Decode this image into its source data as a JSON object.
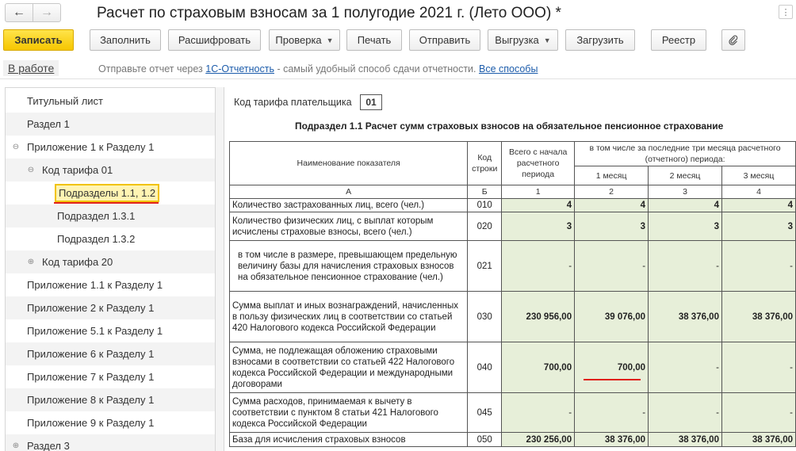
{
  "window": {
    "title": "Расчет по страховым взносам за 1 полугодие 2021 г. (Лето ООО) *",
    "back_icon": "arrow-left-icon",
    "forward_icon": "arrow-right-icon"
  },
  "toolbar": {
    "save": "Записать",
    "fill": "Заполнить",
    "decode": "Расшифровать",
    "check": "Проверка",
    "print": "Печать",
    "send": "Отправить",
    "export": "Выгрузка",
    "load": "Загрузить",
    "registry": "Реестр"
  },
  "status": {
    "in_work": "В работе",
    "msg_prefix": "Отправьте отчет через ",
    "link_1c": "1С-Отчетность",
    "msg_middle": " - самый удобный способ сдачи отчетности. ",
    "link_all": "Все способы"
  },
  "tree": {
    "items": [
      {
        "label": "Титульный лист",
        "toggle": ""
      },
      {
        "label": "Раздел 1",
        "toggle": ""
      },
      {
        "label": "Приложение 1 к Разделу 1",
        "toggle": "⊖"
      },
      {
        "label": "Код тарифа 01",
        "toggle": "⊖"
      },
      {
        "label": "Подразделы 1.1, 1.2",
        "toggle": ""
      },
      {
        "label": "Подраздел 1.3.1",
        "toggle": ""
      },
      {
        "label": "Подраздел 1.3.2",
        "toggle": ""
      },
      {
        "label": "Код тарифа 20",
        "toggle": "⊕"
      },
      {
        "label": "Приложение 1.1 к Разделу 1",
        "toggle": ""
      },
      {
        "label": "Приложение 2 к Разделу 1",
        "toggle": ""
      },
      {
        "label": "Приложение 5.1 к Разделу 1",
        "toggle": ""
      },
      {
        "label": "Приложение 6 к Разделу 1",
        "toggle": ""
      },
      {
        "label": "Приложение 7 к Разделу 1",
        "toggle": ""
      },
      {
        "label": "Приложение 8 к Разделу 1",
        "toggle": ""
      },
      {
        "label": "Приложение 9 к Разделу 1",
        "toggle": ""
      },
      {
        "label": "Раздел 3",
        "toggle": "⊕"
      }
    ]
  },
  "form": {
    "tariff_label": "Код тарифа плательщика",
    "tariff_value": "01",
    "subtitle": "Подраздел 1.1 Расчет сумм страховых взносов на обязательное пенсионное страхование",
    "headers": {
      "name": "Наименование показателя",
      "code": "Код строки",
      "total": "Всего с начала расчетного периода",
      "last3": "в том числе за последние три месяца расчетного (отчетного) периода:",
      "m1": "1 месяц",
      "m2": "2 месяц",
      "m3": "3 месяц",
      "letter_a": "А",
      "letter_b": "Б",
      "n1": "1",
      "n2": "2",
      "n3": "3",
      "n4": "4"
    },
    "rows": [
      {
        "name": "Количество застрахованных лиц, всего (чел.)",
        "code": "010",
        "total": "4",
        "m1": "4",
        "m2": "4",
        "m3": "4"
      },
      {
        "name": "Количество физических лиц, с выплат которым исчислены страховые взносы, всего (чел.)",
        "code": "020",
        "total": "3",
        "m1": "3",
        "m2": "3",
        "m3": "3"
      },
      {
        "name": "в том числе в размере, превышающем предельную величину базы для начисления страховых взносов на обязательное пенсионное страхование (чел.)",
        "code": "021",
        "total": "-",
        "m1": "-",
        "m2": "-",
        "m3": "-"
      },
      {
        "name": "Сумма выплат и иных вознаграждений, начисленных в пользу физических лиц в соответствии со статьей 420 Налогового кодекса Российской Федерации",
        "code": "030",
        "total": "230 956,00",
        "m1": "39 076,00",
        "m2": "38 376,00",
        "m3": "38 376,00"
      },
      {
        "name": "Сумма, не подлежащая обложению страховыми взносами в соответствии со статьей 422 Налогового кодекса Российской Федерации и международными договорами",
        "code": "040",
        "total": "700,00",
        "m1": "700,00",
        "m2": "-",
        "m3": "-"
      },
      {
        "name": "Сумма расходов, принимаемая к вычету в соответствии с пунктом 8 статьи 421 Налогового кодекса Российской Федерации",
        "code": "045",
        "total": "-",
        "m1": "-",
        "m2": "-",
        "m3": "-"
      },
      {
        "name": "База для исчисления страховых взносов",
        "code": "050",
        "total": "230 256,00",
        "m1": "38 376,00",
        "m2": "38 376,00",
        "m3": "38 376,00"
      }
    ]
  },
  "colors": {
    "accent_yellow": "#f6c600",
    "cell_green": "#e7efd9",
    "highlight_red": "#e0201a",
    "link_blue": "#1c5cab"
  }
}
